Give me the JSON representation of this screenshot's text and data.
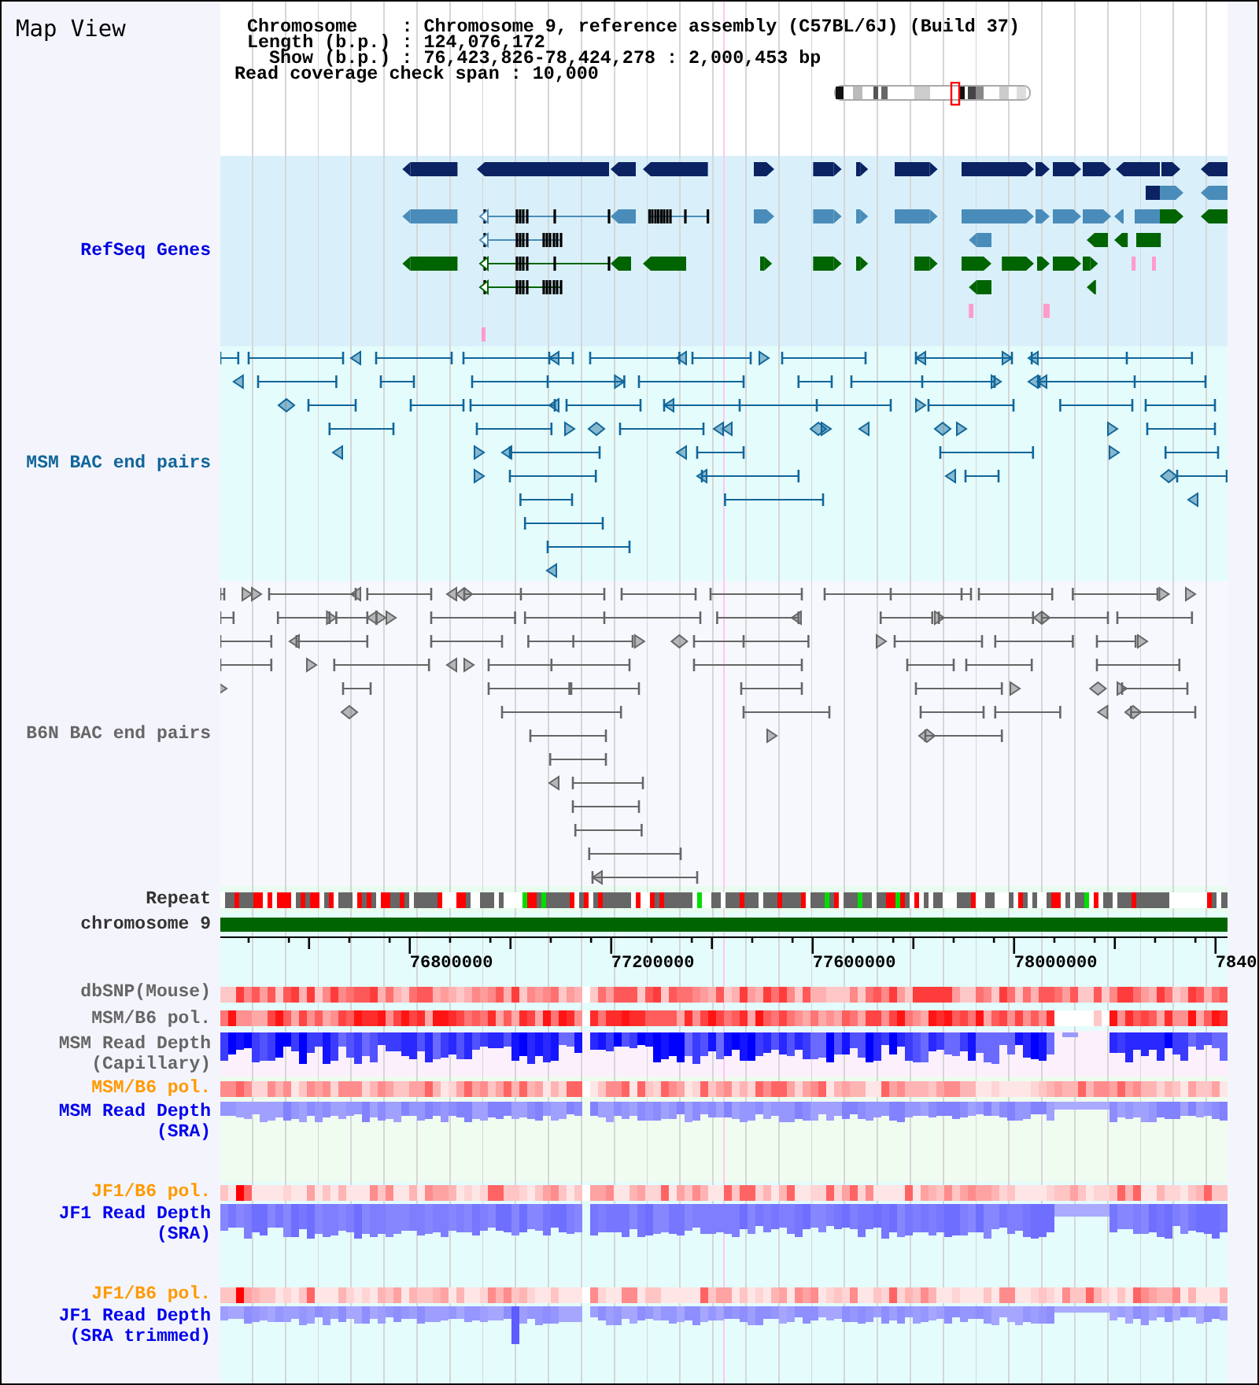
{
  "header": {
    "title": "Map View",
    "info_lines": [
      "Chromosome    : Chromosome 9, reference assembly (C57BL/6J) (Build 37)",
      "Length (b.p.) : 124,076,172",
      "Show (b.p.) : 76,423,826-78,424,278 : 2,000,453 bp",
      "Read coverage check span : 10,000"
    ]
  },
  "tracks": [
    {
      "kind": "genes",
      "label": "RefSeq Genes",
      "color": "#0000dd"
    },
    {
      "kind": "bac_pairs",
      "label": "MSM BAC end pairs",
      "color": "#11669a"
    },
    {
      "kind": "bac_pairs",
      "label": "B6N BAC end pairs",
      "color": "#666666"
    },
    {
      "kind": "repeat",
      "label": "Repeat",
      "color": "#333333"
    },
    {
      "kind": "chromosome",
      "label": "chromosome 9",
      "color": "#333333"
    },
    {
      "kind": "ruler",
      "labels": [
        "76800000",
        "77200000",
        "77600000",
        "78000000",
        "7840"
      ]
    },
    {
      "kind": "heatmap",
      "label": "dbSNP(Mouse)",
      "color": "#666666"
    },
    {
      "kind": "heatmap",
      "label": "MSM/B6 pol.",
      "color": "#666666"
    },
    {
      "kind": "depth",
      "label": "MSM Read Depth (Capillary)",
      "color": "#666666"
    },
    {
      "kind": "heatmap",
      "label": "MSM/B6 pol.",
      "color": "#ff9900"
    },
    {
      "kind": "depth",
      "label": "MSM Read Depth (SRA)",
      "color": "#0000ee"
    },
    {
      "kind": "heatmap",
      "label": "JF1/B6 pol.",
      "color": "#ff9900"
    },
    {
      "kind": "depth",
      "label": "JF1 Read Depth (SRA)",
      "color": "#0000ee"
    },
    {
      "kind": "heatmap",
      "label": "JF1/B6 pol.",
      "color": "#ff9900"
    },
    {
      "kind": "depth",
      "label": "JF1 Read Depth (SRA trimmed)",
      "color": "#0000ee"
    }
  ]
}
